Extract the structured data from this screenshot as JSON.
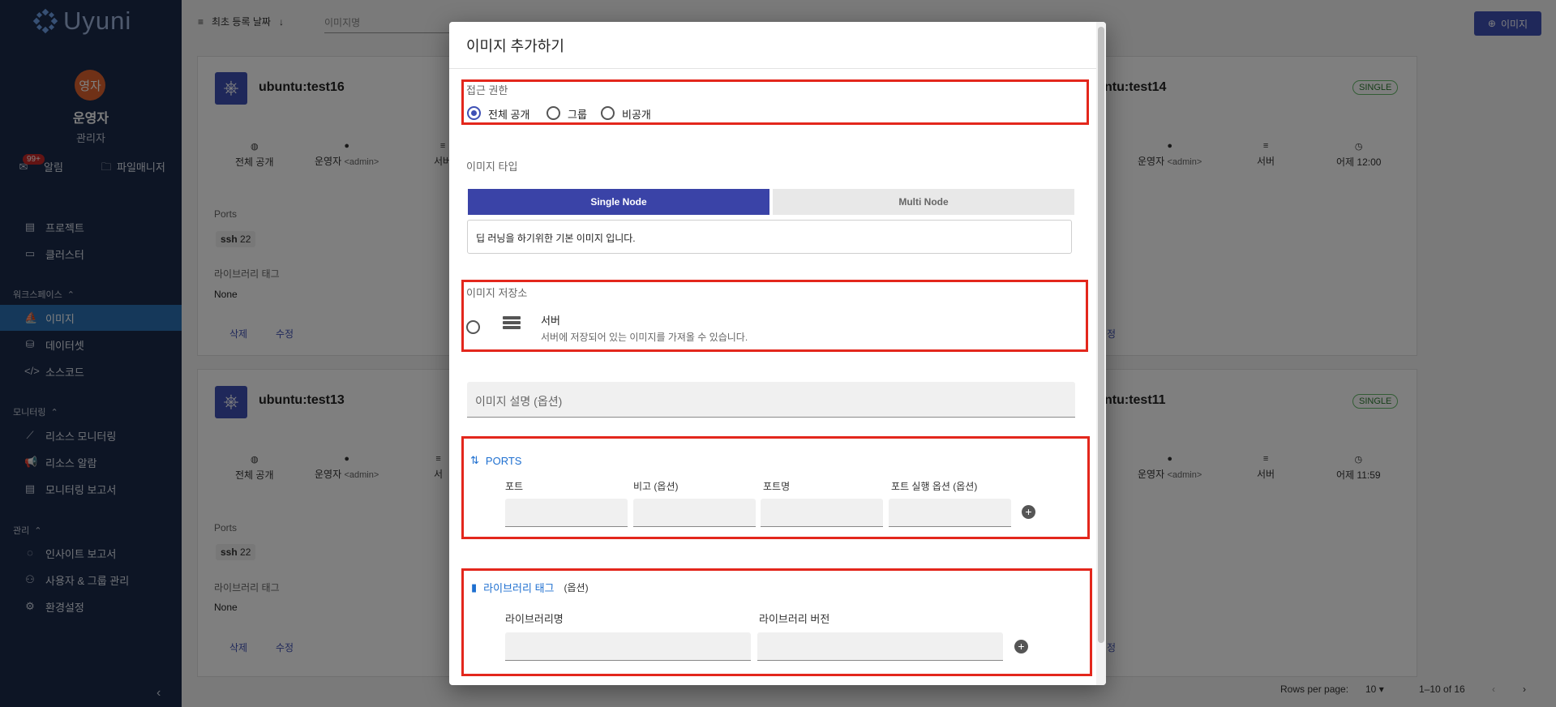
{
  "app": {
    "name": "Uyuni"
  },
  "user": {
    "avatar_text": "영자",
    "name": "운영자",
    "role": "관리자"
  },
  "quick": {
    "notif_badge": "99+",
    "notif_label": "알림",
    "files_label": "파일매니저"
  },
  "sidebar": {
    "items_top": [
      {
        "label": "프로젝트",
        "icon": "clipboard-icon"
      },
      {
        "label": "클러스터",
        "icon": "server-icon"
      }
    ],
    "workspace_title": "워크스페이스",
    "workspace": [
      {
        "label": "이미지",
        "icon": "ship-icon",
        "active": true
      },
      {
        "label": "데이터셋",
        "icon": "database-icon"
      },
      {
        "label": "소스코드",
        "icon": "code-icon"
      }
    ],
    "monitoring_title": "모니터링",
    "monitoring": [
      {
        "label": "리소스 모니터링",
        "icon": "chart-icon"
      },
      {
        "label": "리소스 알람",
        "icon": "megaphone-icon"
      },
      {
        "label": "모니터링 보고서",
        "icon": "report-icon"
      }
    ],
    "admin_title": "관리",
    "admin": [
      {
        "label": "인사이트 보고서",
        "icon": "bulb-icon"
      },
      {
        "label": "사용자 & 그룹 관리",
        "icon": "users-icon"
      },
      {
        "label": "환경설정",
        "icon": "gear-icon"
      }
    ]
  },
  "toolbar": {
    "sort_label": "최초 등록 날짜",
    "search_placeholder": "이미지명",
    "add_button": "이미지"
  },
  "cards": [
    {
      "title": "ubuntu:test16",
      "access": "전체 공개",
      "owner": "운영자",
      "owner_id": "<admin>",
      "storage": "서버",
      "ports_label": "Ports",
      "port": "ssh",
      "port_num": "22",
      "libtag_label": "라이브러리 태그",
      "libtag": "None",
      "delete": "삭제",
      "edit": "수정"
    },
    {
      "title": "ubuntu:test13",
      "access": "전체 공개",
      "owner": "운영자",
      "owner_id": "<admin>",
      "storage": "서",
      "ports_label": "Ports",
      "port": "ssh",
      "port_num": "22",
      "libtag_label": "라이브러리 태그",
      "libtag": "None",
      "delete": "삭제",
      "edit": "수정"
    }
  ],
  "right_cards": [
    {
      "title": "ntu:test14",
      "badge": "SINGLE",
      "owner": "운영자",
      "owner_id": "<admin>",
      "storage": "서버",
      "time": "어제 12:00",
      "edit": "정"
    },
    {
      "title": "ntu:test11",
      "badge": "SINGLE",
      "owner": "운영자",
      "owner_id": "<admin>",
      "storage": "서버",
      "time": "어제 11:59",
      "edit": "정"
    }
  ],
  "pagination": {
    "rows_label": "Rows per page:",
    "rows_value": "10",
    "range": "1–10 of 16"
  },
  "dialog": {
    "title": "이미지 추가하기",
    "access": {
      "label": "접근 권한",
      "options": [
        "전체 공개",
        "그룹",
        "비공개"
      ],
      "selected": "전체 공개"
    },
    "image_type": {
      "label": "이미지 타입",
      "options": [
        "Single Node",
        "Multi Node"
      ],
      "selected": "Single Node",
      "description": "딥 러닝을 하기위한 기본 이미지 입니다."
    },
    "storage": {
      "label": "이미지 저장소",
      "option_title": "서버",
      "option_desc": "서버에 저장되어 있는 이미지를 가져올 수 있습니다."
    },
    "description_placeholder": "이미지 설명 (옵션)",
    "ports": {
      "title": "PORTS",
      "columns": [
        "포트",
        "비고 (옵션)",
        "포트명",
        "포트 실행 옵션 (옵션)"
      ]
    },
    "library": {
      "title": "라이브러리 태그",
      "optional": "(옵션)",
      "columns": [
        "라이브러리명",
        "라이브러리 버전"
      ]
    }
  },
  "colors": {
    "sidebar": "#1b2a4b",
    "accent": "#3f51b5",
    "highlight": "#e3271c",
    "active_nav": "#2b71b4"
  }
}
